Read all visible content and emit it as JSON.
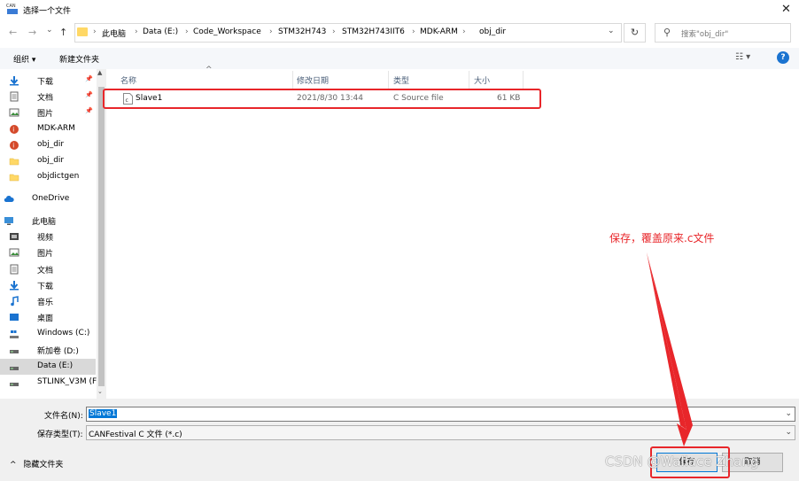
{
  "window": {
    "title": "选择一个文件",
    "close": "✕"
  },
  "nav": {
    "back": "←",
    "forward": "→",
    "dropdown": "⌄",
    "up": "↑"
  },
  "address": {
    "crumbs": [
      "此电脑",
      "Data (E:)",
      "Code_Workspace",
      "STM32H743",
      "STM32H743IIT6",
      "MDK-ARM",
      "obj_dir"
    ],
    "separator": "›",
    "dropdown": "⌄",
    "refresh": "↻"
  },
  "search": {
    "placeholder": "搜索\"obj_dir\"",
    "icon": "⚲"
  },
  "toolbar": {
    "organize": "组织 ▾",
    "new_folder": "新建文件夹",
    "view": "☷ ▾",
    "help": "?"
  },
  "sidebar": {
    "items": [
      {
        "label": "下载",
        "icon": "download-icon",
        "pinned": true
      },
      {
        "label": "文档",
        "icon": "document-icon",
        "pinned": true
      },
      {
        "label": "图片",
        "icon": "picture-icon",
        "pinned": true
      },
      {
        "label": "MDK-ARM",
        "icon": "keil-folder-icon",
        "pinned": false
      },
      {
        "label": "obj_dir",
        "icon": "keil-folder-icon",
        "pinned": false
      },
      {
        "label": "obj_dir",
        "icon": "folder-icon",
        "pinned": false
      },
      {
        "label": "objdictgen",
        "icon": "folder-icon",
        "pinned": false
      },
      {
        "label": "OneDrive",
        "icon": "cloud-icon",
        "pinned": false
      },
      {
        "label": "此电脑",
        "icon": "computer-icon",
        "pinned": false
      },
      {
        "label": "视频",
        "icon": "video-icon",
        "pinned": false
      },
      {
        "label": "图片",
        "icon": "picture-icon",
        "pinned": false
      },
      {
        "label": "文档",
        "icon": "document-icon",
        "pinned": false
      },
      {
        "label": "下载",
        "icon": "download-icon",
        "pinned": false
      },
      {
        "label": "音乐",
        "icon": "music-icon",
        "pinned": false
      },
      {
        "label": "桌面",
        "icon": "desktop-icon",
        "pinned": false
      },
      {
        "label": "Windows (C:)",
        "icon": "windows-drive-icon",
        "pinned": false
      },
      {
        "label": "新加卷 (D:)",
        "icon": "drive-icon",
        "pinned": false
      },
      {
        "label": "Data (E:)",
        "icon": "drive-icon",
        "pinned": false,
        "selected": true
      },
      {
        "label": "STLINK_V3M (F",
        "icon": "drive-icon",
        "pinned": false
      }
    ],
    "pin_glyph": "📌"
  },
  "columns": {
    "name": "名称",
    "modified": "修改日期",
    "type": "类型",
    "size": "大小",
    "sort_arrow": "^"
  },
  "files": [
    {
      "name": "Slave1",
      "modified": "2021/8/30 13:44",
      "type": "C Source file",
      "size": "61 KB",
      "icon": "c-file-icon"
    }
  ],
  "form": {
    "filename_label": "文件名(N):",
    "filename_value": "Slave1",
    "filetype_label": "保存类型(T):",
    "filetype_value": "CANFestival C 文件 (*.c)",
    "dropdown": "⌄"
  },
  "footer": {
    "hide_folders": "隐藏文件夹",
    "hide_arrow": "^",
    "save": "保存",
    "cancel": "取消"
  },
  "annotation": {
    "text": "保存，覆盖原来.c文件",
    "color": "#e8262a"
  },
  "watermark": "CSDN @Wallace Zhang"
}
